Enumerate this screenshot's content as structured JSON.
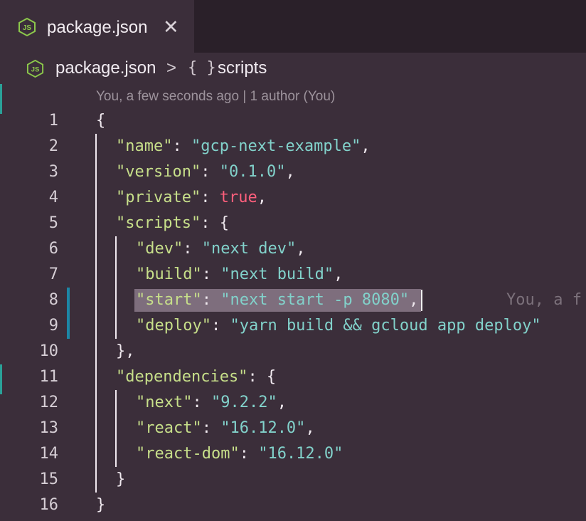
{
  "tab": {
    "title": "package.json",
    "close_glyph": "✕",
    "icon": "nodejs-icon"
  },
  "breadcrumb": {
    "file": "package.json",
    "separator": ">",
    "symbol_glyph": "{ }",
    "symbol": "scripts",
    "icon": "nodejs-icon"
  },
  "codelens": {
    "text": "You, a few seconds ago | 1 author (You)"
  },
  "blame": {
    "text": "You, a f"
  },
  "colors": {
    "key": "#c7df8a",
    "string": "#82d2cb",
    "boolean": "#ff5f7c",
    "background": "#3b2e3a",
    "selection": "#7e6e7d",
    "git_modified": "#1c87a6"
  },
  "lines": [
    {
      "num": "1",
      "indent": 0,
      "tokens": [
        {
          "t": "{",
          "c": "p"
        }
      ]
    },
    {
      "num": "2",
      "indent": 1,
      "tokens": [
        {
          "t": "\"name\"",
          "c": "k"
        },
        {
          "t": ": ",
          "c": "p"
        },
        {
          "t": "\"gcp-next-example\"",
          "c": "s"
        },
        {
          "t": ",",
          "c": "p"
        }
      ]
    },
    {
      "num": "3",
      "indent": 1,
      "tokens": [
        {
          "t": "\"version\"",
          "c": "k"
        },
        {
          "t": ": ",
          "c": "p"
        },
        {
          "t": "\"0.1.0\"",
          "c": "s"
        },
        {
          "t": ",",
          "c": "p"
        }
      ]
    },
    {
      "num": "4",
      "indent": 1,
      "tokens": [
        {
          "t": "\"private\"",
          "c": "k"
        },
        {
          "t": ": ",
          "c": "p"
        },
        {
          "t": "true",
          "c": "b"
        },
        {
          "t": ",",
          "c": "p"
        }
      ]
    },
    {
      "num": "5",
      "indent": 1,
      "tokens": [
        {
          "t": "\"scripts\"",
          "c": "k"
        },
        {
          "t": ": {",
          "c": "p"
        }
      ]
    },
    {
      "num": "6",
      "indent": 2,
      "tokens": [
        {
          "t": "\"dev\"",
          "c": "k"
        },
        {
          "t": ": ",
          "c": "p"
        },
        {
          "t": "\"next dev\"",
          "c": "s"
        },
        {
          "t": ",",
          "c": "p"
        }
      ]
    },
    {
      "num": "7",
      "indent": 2,
      "tokens": [
        {
          "t": "\"build\"",
          "c": "k"
        },
        {
          "t": ": ",
          "c": "p"
        },
        {
          "t": "\"next build\"",
          "c": "s"
        },
        {
          "t": ",",
          "c": "p"
        }
      ]
    },
    {
      "num": "8",
      "indent": 2,
      "selected": true,
      "tokens": [
        {
          "t": "\"start\"",
          "c": "k"
        },
        {
          "t": ": ",
          "c": "p"
        },
        {
          "t": "\"next start -p 8080\"",
          "c": "s"
        },
        {
          "t": ",",
          "c": "p"
        }
      ]
    },
    {
      "num": "9",
      "indent": 2,
      "tokens": [
        {
          "t": "\"deploy\"",
          "c": "k"
        },
        {
          "t": ": ",
          "c": "p"
        },
        {
          "t": "\"yarn build && gcloud app deploy\"",
          "c": "s"
        }
      ]
    },
    {
      "num": "10",
      "indent": 1,
      "tokens": [
        {
          "t": "},",
          "c": "p"
        }
      ]
    },
    {
      "num": "11",
      "indent": 1,
      "tokens": [
        {
          "t": "\"dependencies\"",
          "c": "k"
        },
        {
          "t": ": {",
          "c": "p"
        }
      ]
    },
    {
      "num": "12",
      "indent": 2,
      "tokens": [
        {
          "t": "\"next\"",
          "c": "k"
        },
        {
          "t": ": ",
          "c": "p"
        },
        {
          "t": "\"9.2.2\"",
          "c": "s"
        },
        {
          "t": ",",
          "c": "p"
        }
      ]
    },
    {
      "num": "13",
      "indent": 2,
      "tokens": [
        {
          "t": "\"react\"",
          "c": "k"
        },
        {
          "t": ": ",
          "c": "p"
        },
        {
          "t": "\"16.12.0\"",
          "c": "s"
        },
        {
          "t": ",",
          "c": "p"
        }
      ]
    },
    {
      "num": "14",
      "indent": 2,
      "tokens": [
        {
          "t": "\"react-dom\"",
          "c": "k"
        },
        {
          "t": ": ",
          "c": "p"
        },
        {
          "t": "\"16.12.0\"",
          "c": "s"
        }
      ]
    },
    {
      "num": "15",
      "indent": 1,
      "tokens": [
        {
          "t": "}",
          "c": "p"
        }
      ]
    },
    {
      "num": "16",
      "indent": 0,
      "tokens": [
        {
          "t": "}",
          "c": "p"
        }
      ]
    }
  ]
}
